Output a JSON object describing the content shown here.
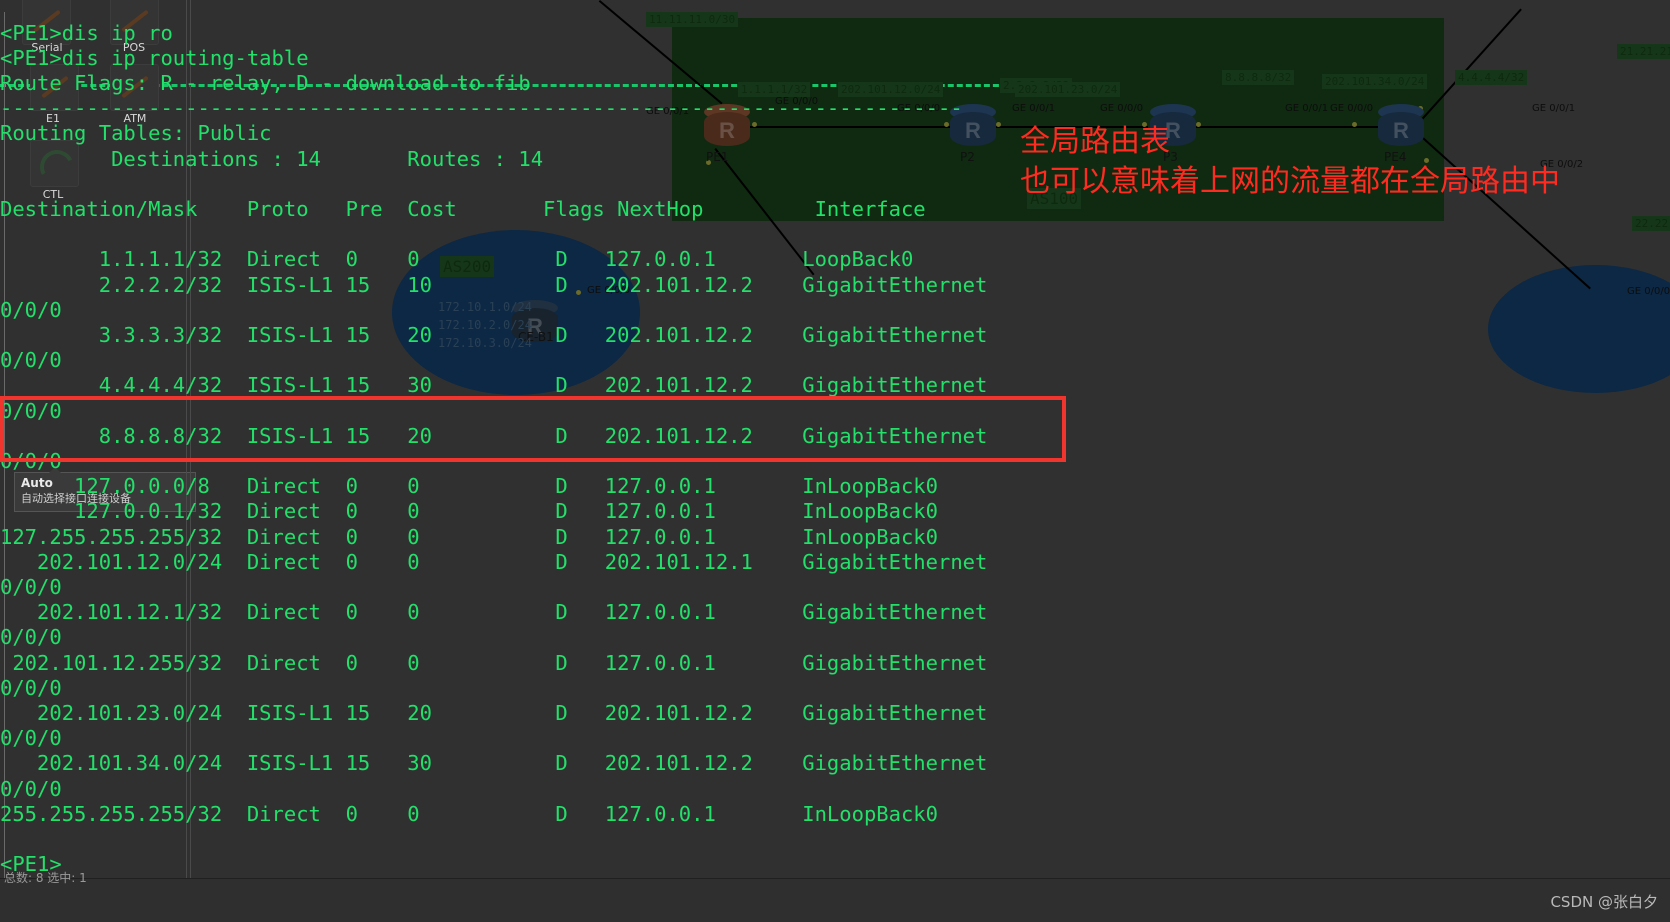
{
  "terminal": {
    "lines": [
      "<PE1>dis ip ro",
      "<PE1>dis ip routing-table",
      "Route Flags: R - relay, D - download to fib",
      "------------------------------------------------------------------------------",
      "Routing Tables: Public",
      "         Destinations : 14       Routes : 14",
      "",
      "Destination/Mask    Proto   Pre  Cost       Flags NextHop         Interface",
      "",
      "        1.1.1.1/32  Direct  0    0           D   127.0.0.1       LoopBack0",
      "        2.2.2.2/32  ISIS-L1 15   10          D   202.101.12.2    GigabitEthernet",
      "0/0/0",
      "        3.3.3.3/32  ISIS-L1 15   20          D   202.101.12.2    GigabitEthernet",
      "0/0/0",
      "        4.4.4.4/32  ISIS-L1 15   30          D   202.101.12.2    GigabitEthernet",
      "0/0/0",
      "        8.8.8.8/32  ISIS-L1 15   20          D   202.101.12.2    GigabitEthernet",
      "0/0/0",
      "      127.0.0.0/8   Direct  0    0           D   127.0.0.1       InLoopBack0",
      "      127.0.0.1/32  Direct  0    0           D   127.0.0.1       InLoopBack0",
      "127.255.255.255/32  Direct  0    0           D   127.0.0.1       InLoopBack0",
      "   202.101.12.0/24  Direct  0    0           D   202.101.12.1    GigabitEthernet",
      "0/0/0",
      "   202.101.12.1/32  Direct  0    0           D   127.0.0.1       GigabitEthernet",
      "0/0/0",
      " 202.101.12.255/32  Direct  0    0           D   127.0.0.1       GigabitEthernet",
      "0/0/0",
      "   202.101.23.0/24  ISIS-L1 15   20          D   202.101.12.2    GigabitEthernet",
      "0/0/0",
      "   202.101.34.0/24  ISIS-L1 15   30          D   202.101.12.2    GigabitEthernet",
      "0/0/0",
      "255.255.255.255/32  Direct  0    0           D   127.0.0.1       InLoopBack0",
      "",
      "<PE1>"
    ],
    "prompt_symbol": "<PE1>",
    "commands": [
      "dis ip ro",
      "dis ip routing-table"
    ],
    "route_flags_legend": "Route Flags: R - relay, D - download to fib",
    "table_title": "Routing Tables: Public",
    "destinations_label": "Destinations :",
    "destinations_count": "14",
    "routes_label": "Routes :",
    "routes_count": "14",
    "columns": [
      "Destination/Mask",
      "Proto",
      "Pre",
      "Cost",
      "Flags",
      "NextHop",
      "Interface"
    ],
    "rows": [
      {
        "dest": "1.1.1.1/32",
        "proto": "Direct",
        "pre": "0",
        "cost": "0",
        "flags": "D",
        "nexthop": "127.0.0.1",
        "interface": "LoopBack0"
      },
      {
        "dest": "2.2.2.2/32",
        "proto": "ISIS-L1",
        "pre": "15",
        "cost": "10",
        "flags": "D",
        "nexthop": "202.101.12.2",
        "interface": "GigabitEthernet0/0/0"
      },
      {
        "dest": "3.3.3.3/32",
        "proto": "ISIS-L1",
        "pre": "15",
        "cost": "20",
        "flags": "D",
        "nexthop": "202.101.12.2",
        "interface": "GigabitEthernet0/0/0"
      },
      {
        "dest": "4.4.4.4/32",
        "proto": "ISIS-L1",
        "pre": "15",
        "cost": "30",
        "flags": "D",
        "nexthop": "202.101.12.2",
        "interface": "GigabitEthernet0/0/0"
      },
      {
        "dest": "8.8.8.8/32",
        "proto": "ISIS-L1",
        "pre": "15",
        "cost": "20",
        "flags": "D",
        "nexthop": "202.101.12.2",
        "interface": "GigabitEthernet0/0/0",
        "highlighted": true
      },
      {
        "dest": "127.0.0.0/8",
        "proto": "Direct",
        "pre": "0",
        "cost": "0",
        "flags": "D",
        "nexthop": "127.0.0.1",
        "interface": "InLoopBack0"
      },
      {
        "dest": "127.0.0.1/32",
        "proto": "Direct",
        "pre": "0",
        "cost": "0",
        "flags": "D",
        "nexthop": "127.0.0.1",
        "interface": "InLoopBack0"
      },
      {
        "dest": "127.255.255.255/32",
        "proto": "Direct",
        "pre": "0",
        "cost": "0",
        "flags": "D",
        "nexthop": "127.0.0.1",
        "interface": "InLoopBack0"
      },
      {
        "dest": "202.101.12.0/24",
        "proto": "Direct",
        "pre": "0",
        "cost": "0",
        "flags": "D",
        "nexthop": "202.101.12.1",
        "interface": "GigabitEthernet0/0/0"
      },
      {
        "dest": "202.101.12.1/32",
        "proto": "Direct",
        "pre": "0",
        "cost": "0",
        "flags": "D",
        "nexthop": "127.0.0.1",
        "interface": "GigabitEthernet0/0/0"
      },
      {
        "dest": "202.101.12.255/32",
        "proto": "Direct",
        "pre": "0",
        "cost": "0",
        "flags": "D",
        "nexthop": "127.0.0.1",
        "interface": "GigabitEthernet0/0/0"
      },
      {
        "dest": "202.101.23.0/24",
        "proto": "ISIS-L1",
        "pre": "15",
        "cost": "20",
        "flags": "D",
        "nexthop": "202.101.12.2",
        "interface": "GigabitEthernet0/0/0"
      },
      {
        "dest": "202.101.34.0/24",
        "proto": "ISIS-L1",
        "pre": "15",
        "cost": "30",
        "flags": "D",
        "nexthop": "202.101.12.2",
        "interface": "GigabitEthernet0/0/0"
      },
      {
        "dest": "255.255.255.255/32",
        "proto": "Direct",
        "pre": "0",
        "cost": "0",
        "flags": "D",
        "nexthop": "127.0.0.1",
        "interface": "InLoopBack0"
      }
    ]
  },
  "annotations": {
    "line1": "全局路由表",
    "line2": "也可以意味着上网的流量都在全局路由中",
    "color": "#ff2b20",
    "highlight_box_color": "#f0342e"
  },
  "palette": {
    "items": [
      {
        "label": "Serial",
        "icon": "serial-link-icon"
      },
      {
        "label": "POS",
        "icon": "pos-link-icon"
      },
      {
        "label": "E1",
        "icon": "e1-link-icon"
      },
      {
        "label": "ATM",
        "icon": "atm-link-icon"
      },
      {
        "label": "CTL",
        "icon": "ctl-link-icon"
      }
    ],
    "tooltip": {
      "title": "Auto",
      "desc": "自动选择接口连接设备"
    }
  },
  "topology": {
    "as_zones": [
      {
        "name": "AS100",
        "color": "#0f2a10"
      },
      {
        "name": "AS200",
        "color": "#0c2844"
      }
    ],
    "routers": [
      {
        "name": "PE1",
        "color": "brown"
      },
      {
        "name": "P2",
        "color": "navy"
      },
      {
        "name": "P3",
        "color": "navy"
      },
      {
        "name": "PE4",
        "color": "navy"
      },
      {
        "name": "CE-B1",
        "color": "dark"
      }
    ],
    "net_labels": [
      "11.11.11.0/30",
      "1.1.1.1/32",
      "202.101.12.0/24",
      "2.2.2.2/32",
      "202.101.23.0/24",
      "8.8.8.8/32",
      "202.101.34.0/24",
      "4.4.4.4/32",
      "21.21.21",
      "22.22"
    ],
    "ce_subnets": [
      "172.10.1.0/24",
      "172.10.2.0/24",
      "172.10.3.0/24"
    ],
    "interface_labels": [
      "GE 0/0/1",
      "GE 0/0/0",
      "GE 0/0/0",
      "GE 0/0/1",
      "GE 0/0/0",
      "GE 0/0/1",
      "GE 0/0/0",
      "GE 0/0/1",
      "GE 0/0/2",
      "GE 0/0/0"
    ]
  },
  "statusbar": {
    "count_text": "总数: 8 选中: 1",
    "watermark": "CSDN @张白夕"
  }
}
